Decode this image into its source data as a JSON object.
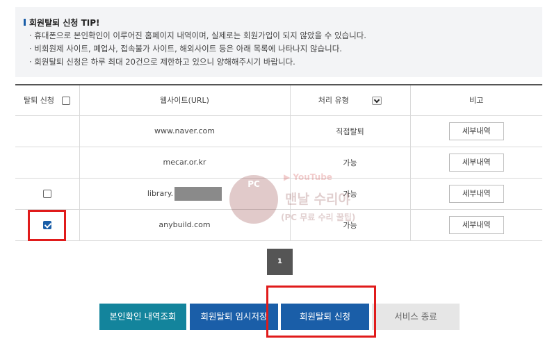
{
  "tip": {
    "title": "회원탈퇴 신청 TIP!",
    "lines": [
      "· 휴대폰으로 본인확인이 이루어진 홈페이지 내역이며, 실제로는 회원가입이 되지 않았을 수 있습니다.",
      "· 비회원제 사이트, 폐업사, 접속불가 사이트, 해외사이트 등은 아래 목록에 나타나지 않습니다.",
      "· 회원탈퇴 신청은 하루 최대 20건으로 제한하고 있으니 양해해주시기 바랍니다."
    ]
  },
  "table": {
    "headers": [
      "탈퇴 신청",
      "웹사이트(URL)",
      "처리 유형",
      "비고"
    ],
    "rows": [
      {
        "url": "www.naver.com",
        "type": "직접탈퇴",
        "note": "세부내역",
        "checkbox": "none"
      },
      {
        "url": "mecar.or.kr",
        "type": "가능",
        "note": "세부내역",
        "checkbox": "none"
      },
      {
        "url": "library.",
        "type": "가능",
        "note": "세부내역",
        "checkbox": "unchecked"
      },
      {
        "url": "anybuild.com",
        "type": "가능",
        "note": "세부내역",
        "checkbox": "checked"
      }
    ]
  },
  "watermark": {
    "badge": "PC",
    "youtube": "▶ YouTube",
    "main": "맨날 수리야",
    "sub": "(PC 무료 수리 꿀팁)"
  },
  "pagination": {
    "current": "1"
  },
  "buttons": {
    "verify_history": "본인확인 내역조회",
    "temp_save": "회원탈퇴 임시저장",
    "apply": "회원탈퇴 신청",
    "end_service": "서비스 종료"
  },
  "colors": {
    "accent": "#1a5ea8",
    "teal": "#13849c",
    "highlight": "#e01b1b"
  }
}
